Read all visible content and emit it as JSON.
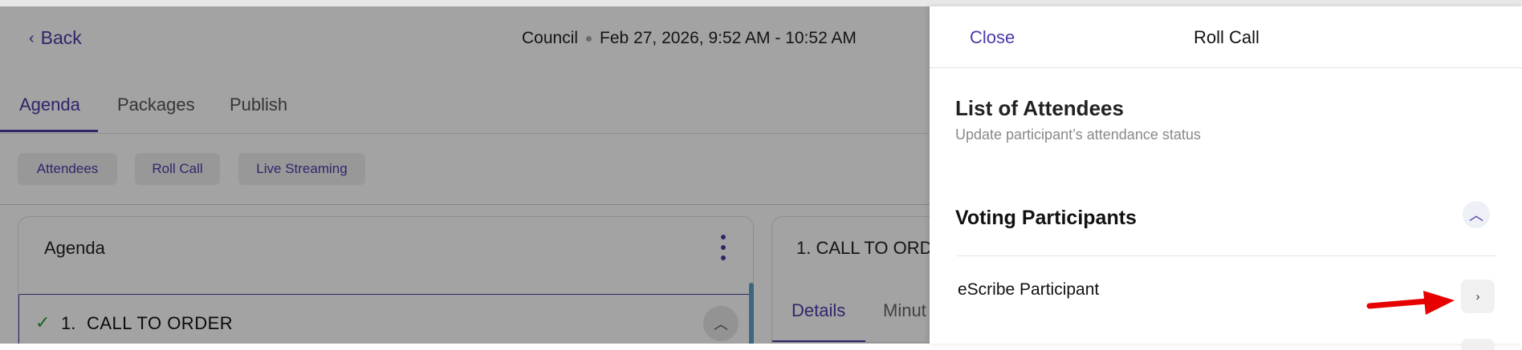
{
  "header": {
    "back_label": "Back",
    "meeting_name": "Council",
    "meeting_datetime": "Feb 27, 2026, 9:52 AM - 10:52 AM"
  },
  "tabs": [
    {
      "label": "Agenda",
      "active": true
    },
    {
      "label": "Packages",
      "active": false
    },
    {
      "label": "Publish",
      "active": false
    }
  ],
  "actions": [
    {
      "label": "Attendees"
    },
    {
      "label": "Roll Call"
    },
    {
      "label": "Live Streaming"
    }
  ],
  "agenda_panel": {
    "title": "Agenda",
    "item": {
      "number": "1.",
      "title": "CALL TO ORDER",
      "completed": true
    }
  },
  "detail_panel": {
    "title": "1. CALL TO ORD",
    "tabs": [
      {
        "label": "Details",
        "active": true
      },
      {
        "label": "Minut",
        "active": false
      }
    ]
  },
  "drawer": {
    "close_label": "Close",
    "title": "Roll Call",
    "section_title": "List of Attendees",
    "section_subtitle": "Update participant’s attendance status",
    "group_title": "Voting Participants",
    "participants": [
      {
        "name": "eScribe Participant"
      }
    ]
  },
  "icons": {
    "back": "chevron-left-icon",
    "check": "check-icon",
    "collapse": "chevron-up-icon",
    "more": "kebab-menu-icon",
    "participant_action": "chevron-right-icon",
    "annotation": "red-arrow"
  },
  "colors": {
    "accent": "#4a3aa8",
    "success": "#2b9a3a",
    "annotation": "#e60000"
  }
}
